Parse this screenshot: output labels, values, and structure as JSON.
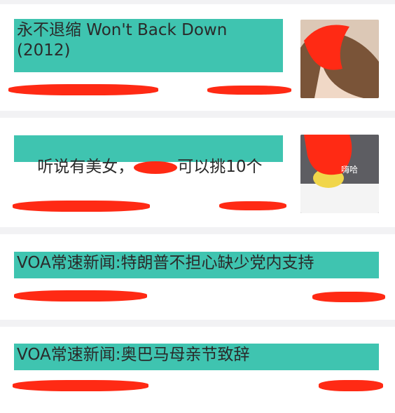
{
  "feed": {
    "items": [
      {
        "title": "永不退缩 Won't Back Down\n(2012)"
      },
      {
        "title_pre": "听说有美女，",
        "title_post": "可以挑10个",
        "thumb_caption": "嗨哈"
      },
      {
        "title": "VOA常速新闻:特朗普不担心缺少党内支持"
      },
      {
        "title": "VOA常速新闻:奥巴马母亲节致辞"
      }
    ]
  },
  "colors": {
    "title_highlight": "#3fc4b0",
    "redaction": "#ff2a14",
    "separator": "#f2f2f4"
  }
}
